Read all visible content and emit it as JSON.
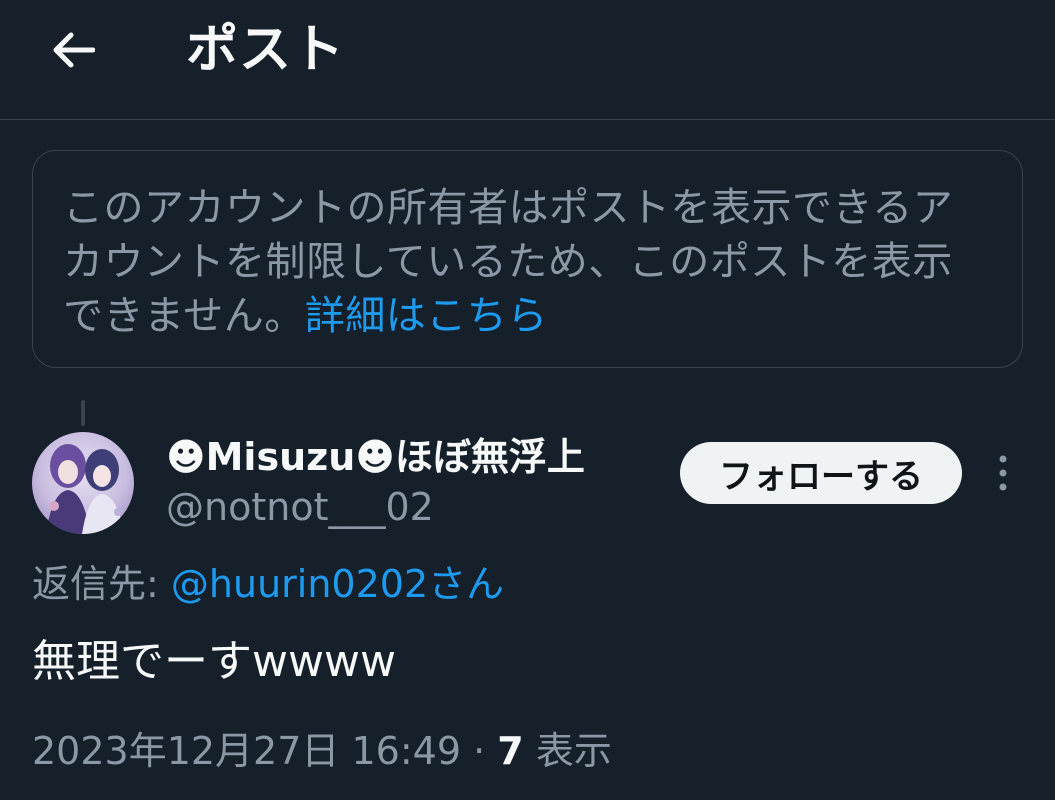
{
  "header": {
    "back_icon": "arrow-left-icon",
    "title": "ポスト"
  },
  "notice": {
    "text": "このアカウントの所有者はポストを表示できるアカウントを制限しているため、このポストを表示できません。",
    "link": "詳細はこちら"
  },
  "tweet": {
    "display_name": "☻Misuzu☻ほぼ無浮上",
    "handle": "@notnot___02",
    "follow_label": "フォローする",
    "more_icon": "more-vertical-icon",
    "reply_label": "返信先:",
    "reply_to": "@huurin0202さん",
    "text": "無理でーすwwww",
    "timestamp": "2023年12月27日 16:49",
    "separator": "·",
    "view_count": "7",
    "views_label": "表示"
  },
  "colors": {
    "background": "#15202b",
    "border": "#38444d",
    "secondary_text": "#8b98a5",
    "link": "#1d9bf0",
    "primary_text": "#f7f9f9"
  }
}
